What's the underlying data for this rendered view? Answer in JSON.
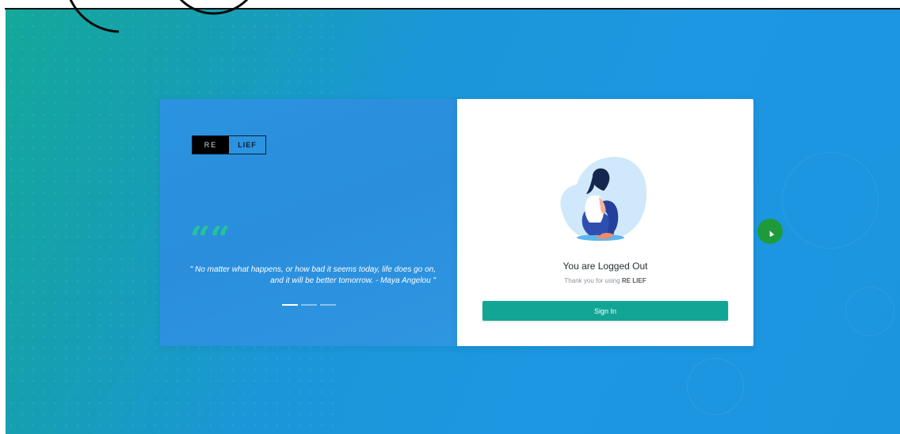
{
  "brand": {
    "logo_left": "RE",
    "logo_right": "LIEF"
  },
  "quote": {
    "mark": "““",
    "text": "\" No matter what happens, or how bad it seems today, life does go on, and it will be better tomorrow. - Maya Angelou \""
  },
  "carousel": {
    "count": 3,
    "active_index": 0
  },
  "logout": {
    "title": "You are Logged Out",
    "subtitle_prefix": "Thank you for using",
    "subtitle_brand": "RE LIEF",
    "signin_label": "Sign In"
  },
  "colors": {
    "accent_teal": "#12a596",
    "quote_mark": "#25c39a",
    "background_blue": "#1c97e2",
    "background_teal": "#14a89a",
    "cursor_highlight": "#1f9a3a"
  },
  "icons": {
    "illustration": "woman-sitting-hugging-knees-illustration",
    "cursor": "mouse-pointer-icon"
  }
}
